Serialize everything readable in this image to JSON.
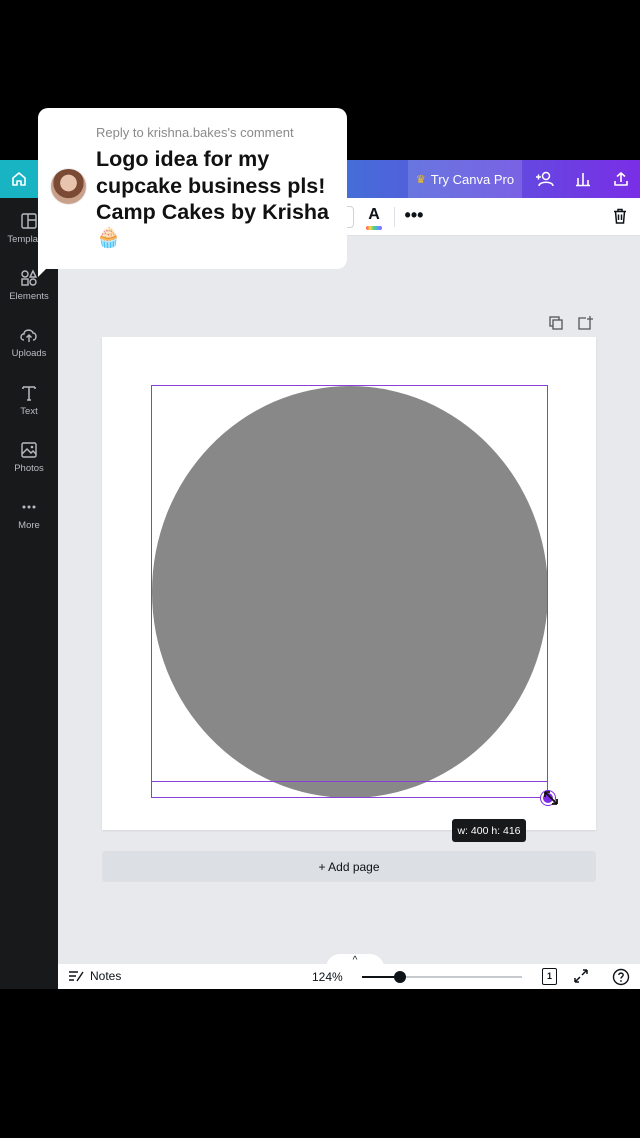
{
  "reply": {
    "header": "Reply to krishna.bakes's comment",
    "message": "Logo idea for my cupcake business pls! Camp Cakes by Krisha",
    "emoji": "🧁"
  },
  "topbar": {
    "pro_label": "Try Canva Pro",
    "icons": [
      "home-icon",
      "share-people-icon",
      "stats-icon",
      "upload-icon"
    ]
  },
  "toolbar": {
    "text_color_glyph": "A",
    "more_glyph": "•••"
  },
  "sidebar": {
    "items": [
      {
        "label": "Templates",
        "icon": "templates-icon"
      },
      {
        "label": "Elements",
        "icon": "elements-icon"
      },
      {
        "label": "Uploads",
        "icon": "uploads-icon"
      },
      {
        "label": "Text",
        "icon": "text-icon"
      },
      {
        "label": "Photos",
        "icon": "photos-icon"
      },
      {
        "label": "More",
        "icon": "more-icon"
      }
    ]
  },
  "canvas": {
    "shape_color": "#888888",
    "selection_color": "#8b3fd9",
    "size_tooltip": "w: 400 h: 416",
    "add_page_label": "+ Add page"
  },
  "footer": {
    "notes_label": "Notes",
    "zoom_label": "124%",
    "zoom_fraction": 0.24,
    "page_count": "1",
    "tab_glyph": "^"
  }
}
